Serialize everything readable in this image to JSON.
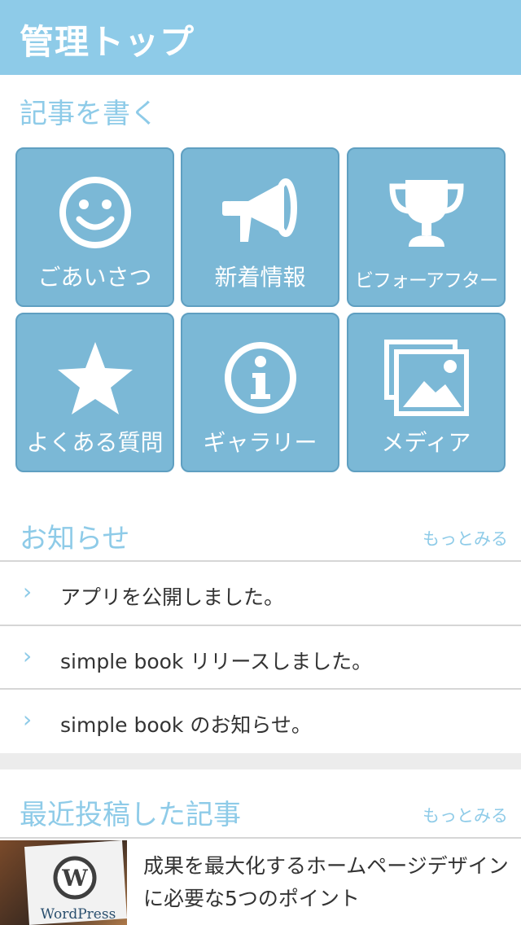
{
  "header": {
    "title": "管理トップ"
  },
  "write_section": {
    "title": "記事を書く",
    "tiles": [
      {
        "label": "ごあいさつ",
        "icon": "smiley-icon"
      },
      {
        "label": "新着情報",
        "icon": "megaphone-icon"
      },
      {
        "label": "ビフォーアフター",
        "icon": "trophy-icon"
      },
      {
        "label": "よくある質問",
        "icon": "star-icon"
      },
      {
        "label": "ギャラリー",
        "icon": "info-icon"
      },
      {
        "label": "メディア",
        "icon": "images-icon"
      }
    ]
  },
  "news_section": {
    "title": "お知らせ",
    "more": "もっとみる",
    "items": [
      "アプリを公開しました。",
      "simple book リリースしました。",
      "simple book のお知らせ。"
    ]
  },
  "recent_section": {
    "title": "最近投稿した記事",
    "more": "もっとみる",
    "article": {
      "title": "成果を最大化するホームページデザインに必要な5つのポイント",
      "thumb_text": "WordPress"
    }
  },
  "colors": {
    "accent": "#8ecbe8",
    "tile": "#7bb8d6",
    "tile_border": "#5f9fc1"
  }
}
